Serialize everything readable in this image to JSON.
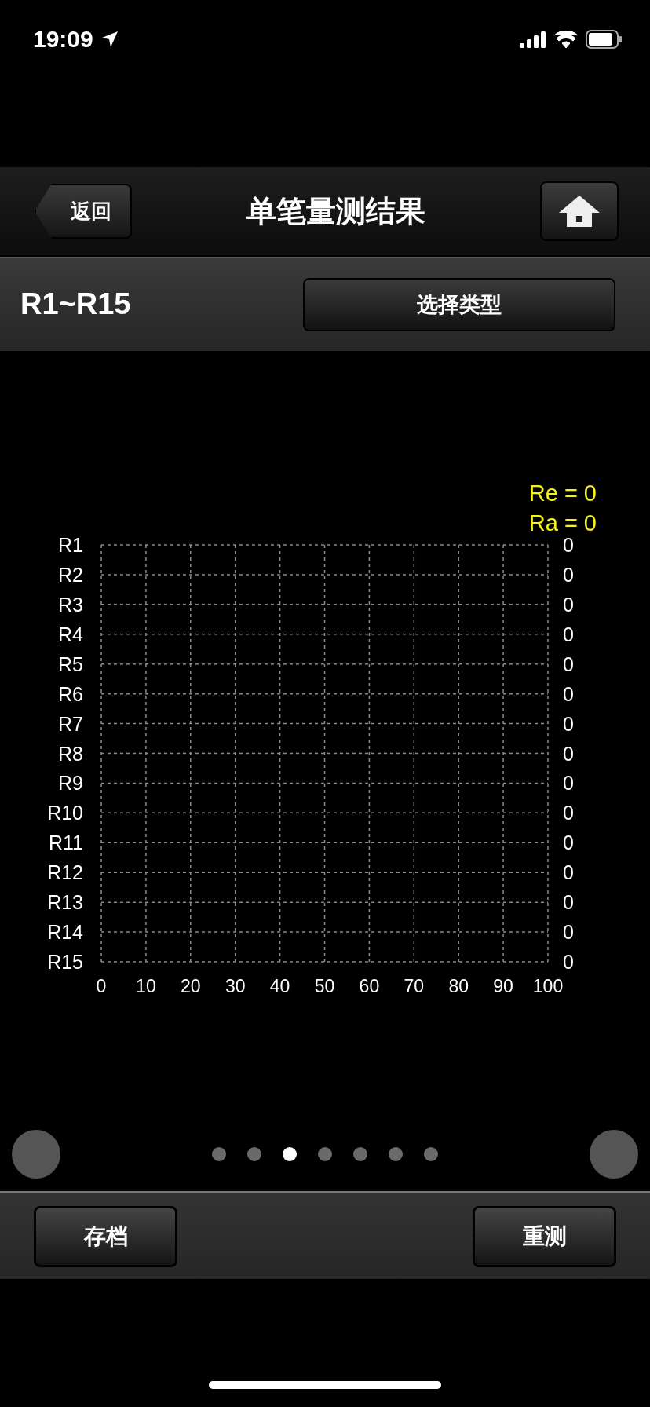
{
  "status_bar": {
    "time": "19:09"
  },
  "nav_bar": {
    "back": "返回",
    "title": "单笔量测结果"
  },
  "sub_bar": {
    "range": "R1~R15",
    "select_button": "选择类型"
  },
  "summary": [
    "Re = 0",
    "Ra = 0"
  ],
  "chart_data": {
    "type": "bar",
    "orientation": "horizontal",
    "categories": [
      "R1",
      "R2",
      "R3",
      "R4",
      "R5",
      "R6",
      "R7",
      "R8",
      "R9",
      "R10",
      "R11",
      "R12",
      "R13",
      "R14",
      "R15"
    ],
    "values": [
      0,
      0,
      0,
      0,
      0,
      0,
      0,
      0,
      0,
      0,
      0,
      0,
      0,
      0,
      0
    ],
    "value_labels": [
      "0",
      "0",
      "0",
      "0",
      "0",
      "0",
      "0",
      "0",
      "0",
      "0",
      "0",
      "0",
      "0",
      "0",
      "0"
    ],
    "xlim": [
      0,
      100
    ],
    "grid": true,
    "xticks": [
      0,
      10,
      20,
      30,
      40,
      50,
      60,
      70,
      80,
      90,
      100
    ]
  },
  "pages": [
    {
      "selected": false
    },
    {
      "selected": false
    },
    {
      "selected": true
    },
    {
      "selected": false
    },
    {
      "selected": false
    },
    {
      "selected": false
    },
    {
      "selected": false
    }
  ],
  "bottom_bar": {
    "save": "存档",
    "retest": "重测"
  }
}
